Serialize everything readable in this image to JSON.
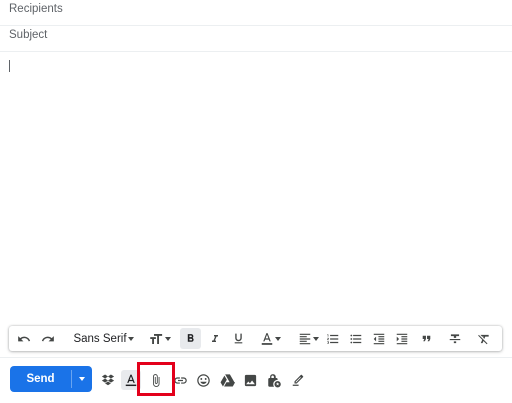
{
  "compose": {
    "recipients_placeholder": "Recipients",
    "subject_placeholder": "Subject",
    "body_text": ""
  },
  "format_toolbar": {
    "font_family": "Sans Serif",
    "icons": [
      "undo-icon",
      "redo-icon",
      "font-size-icon",
      "bold-icon",
      "italic-icon",
      "underline-icon",
      "text-color-icon",
      "align-icon",
      "numbered-list-icon",
      "bulleted-list-icon",
      "indent-less-icon",
      "indent-more-icon",
      "quote-icon",
      "strikethrough-icon",
      "remove-formatting-icon"
    ],
    "bold_active": true
  },
  "actions": {
    "send_label": "Send",
    "icons": [
      "dropbox-icon",
      "formatting-options-icon",
      "paperclip-icon",
      "link-icon",
      "emoji-icon",
      "drive-icon",
      "photo-icon",
      "confidential-mode-icon",
      "signature-icon"
    ],
    "highlighted": "paperclip-icon"
  },
  "colors": {
    "send_button": "#1a73e8",
    "highlight": "#e3001b",
    "icon": "#444746",
    "placeholder": "#5f6368"
  }
}
